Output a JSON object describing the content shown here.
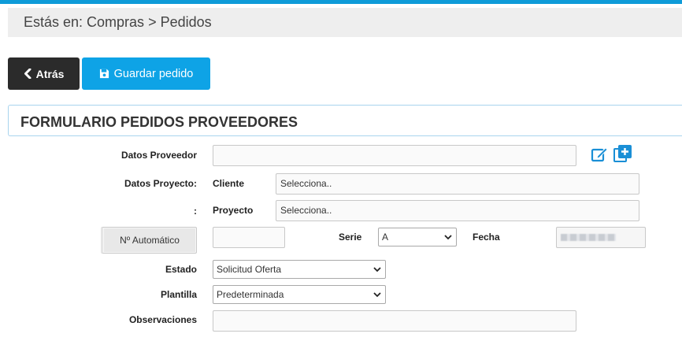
{
  "breadcrumb": {
    "text": "Estás en: Compras > Pedidos"
  },
  "toolbar": {
    "back_label": "Atrás",
    "save_label": "Guardar pedido"
  },
  "panel": {
    "title": "FORMULARIO PEDIDOS PROVEEDORES"
  },
  "form": {
    "proveedor_label": "Datos Proveedor",
    "proyecto_label": "Datos Proyecto:",
    "colon_label": ":",
    "cliente_label": "Cliente",
    "cliente_value": "Selecciona..",
    "proyecto_sub_label": "Proyecto",
    "proyecto_value": "Selecciona..",
    "numero_button": "Nº Automático",
    "serie_label": "Serie",
    "serie_value": "A",
    "fecha_label": "Fecha",
    "estado_label": "Estado",
    "estado_value": "Solicitud Oferta",
    "plantilla_label": "Plantilla",
    "plantilla_value": "Predeterminada",
    "observaciones_label": "Observaciones"
  },
  "colors": {
    "accent": "#0ea3e6",
    "dark_button": "#2b2b2b",
    "icon_blue": "#1a8fd6"
  },
  "icons": [
    "chevron-left-icon",
    "floppy-disk-icon",
    "edit-icon",
    "add-box-icon",
    "chevron-down-icon"
  ]
}
